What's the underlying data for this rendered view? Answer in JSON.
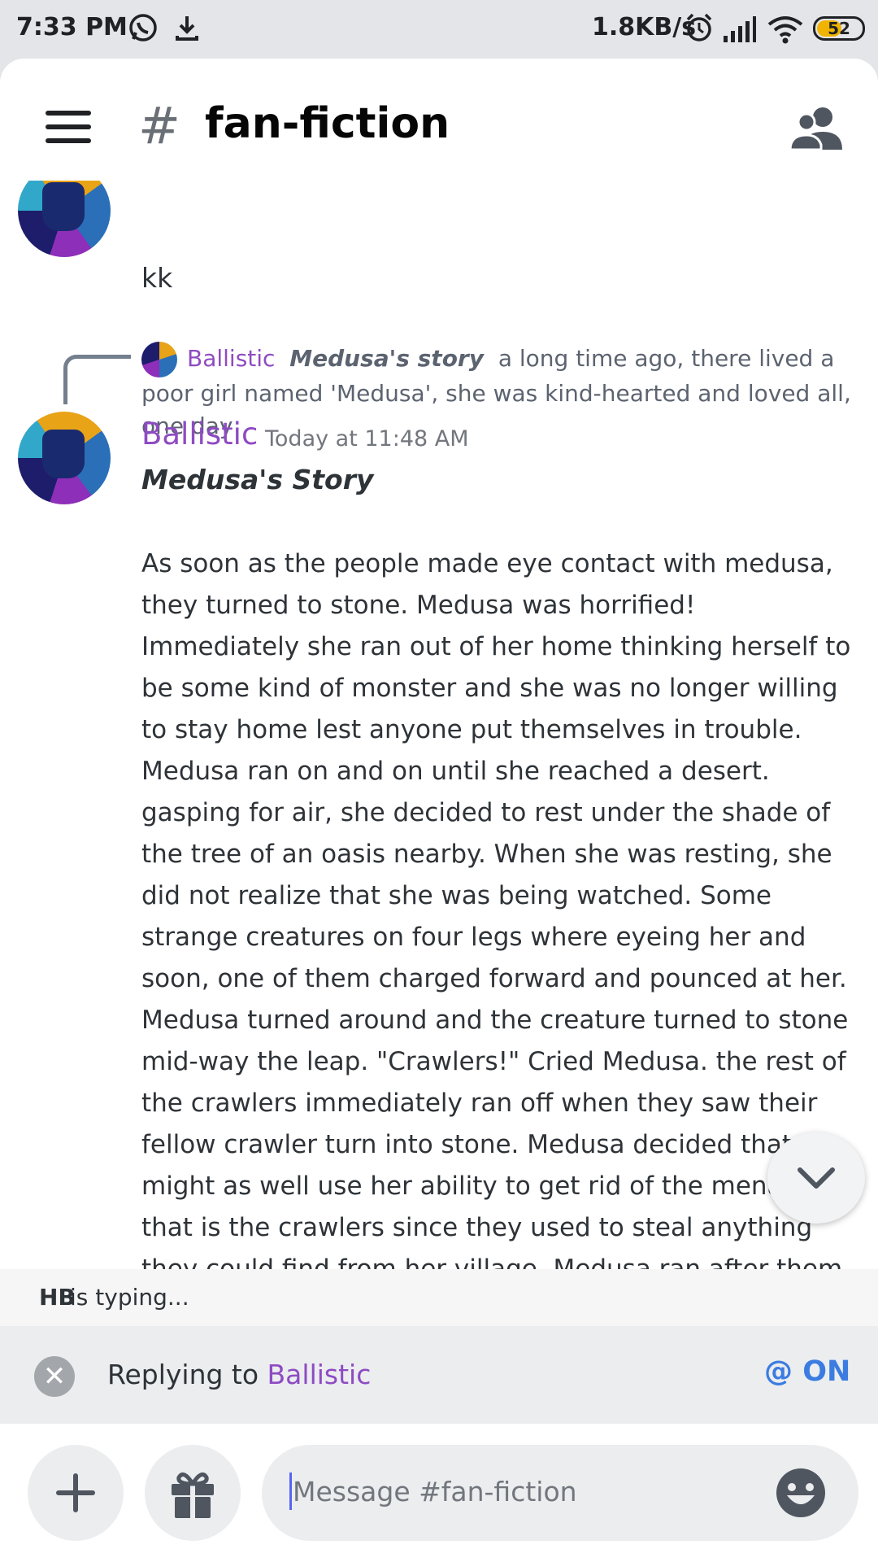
{
  "status_bar": {
    "time": "7:33 PM",
    "net_speed": "1.8KB/s",
    "battery": "52",
    "battery_level_percent": 52,
    "icons": [
      "whatsapp-icon",
      "download-icon",
      "alarm-icon",
      "signal-icon",
      "wifi-icon",
      "battery-icon"
    ]
  },
  "header": {
    "hash": "#",
    "channel_name": "fan-fiction"
  },
  "messages": {
    "previous_text": "kk",
    "reply_preview": {
      "author": "Ballistic",
      "title": "Medusa's story",
      "snippet": "a long time ago, there lived a poor girl named 'Medusa', she was kind-hearted and loved all, one day"
    },
    "current": {
      "author": "Ballistic",
      "timestamp": "Today at 11:48 AM",
      "title": "Medusa's Story",
      "body": "As soon as the people made eye contact with medusa, they turned to stone. Medusa was horrified! Immediately she ran out of her home thinking herself to be some kind of monster and she was no longer willing to stay home lest anyone put themselves in trouble. Medusa ran on and on until she reached a desert. gasping for air, she decided to rest under the shade of the tree of an oasis nearby. When she was resting, she did not realize that she was being watched. Some strange creatures on four legs where eyeing her and soon, one of them charged forward and pounced at her. Medusa turned around and the creature turned to stone mid-way the leap. \"Crawlers!\" Cried Medusa. the rest of the crawlers immediately ran off when they saw their fellow crawler turn into stone. Medusa decided that she might as well use her ability to get rid of the menace that is the crawlers since they used to steal anything they could find from her village. Medusa ran after them. The crawlers were faster than her. When one of them looked back and saw medusa, even he turned to stone. The other crawlers went"
    }
  },
  "typing": {
    "user": "HB",
    "text": " is typing..."
  },
  "reply_bar": {
    "prefix": "Replying to ",
    "target": "Ballistic",
    "mention_symbol": "@",
    "mention_state": "ON"
  },
  "composer": {
    "placeholder": "Message #fan-fiction"
  },
  "colors": {
    "author": "#8e4bc2",
    "mention_on": "#3c7ce0",
    "background": "#ffffff",
    "chrome": "#e3e5e8"
  }
}
